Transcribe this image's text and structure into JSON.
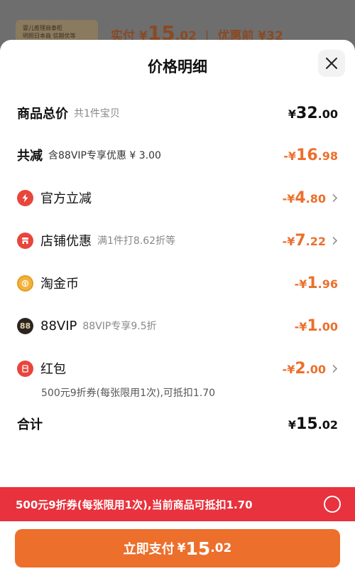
{
  "background": {
    "thumb_lines": [
      "婴儿推理商泰柜",
      "明照日本商 信期优等"
    ],
    "paid_label": "实付",
    "paid_symbol": "¥",
    "paid_int": "15",
    "paid_dec": ".02",
    "separator": "|",
    "before_discount": "优惠前 ¥32"
  },
  "sheet": {
    "title": "价格明细",
    "close_icon": "close-icon"
  },
  "rows": {
    "total": {
      "label": "商品总价",
      "sub": "共1件宝贝",
      "sym": "¥",
      "int": "32",
      "dec": ".00"
    },
    "reduce": {
      "label": "共减",
      "sub": "含88VIP专享优惠 ¥ 3.00",
      "sym": "-¥",
      "int": "16",
      "dec": ".98"
    },
    "official": {
      "label": "官方立减",
      "sym": "-¥",
      "int": "4",
      "dec": ".80",
      "icon": "lightning-icon"
    },
    "store": {
      "label": "店铺优惠",
      "sub": "满1件打8.62折等",
      "sym": "-¥",
      "int": "7",
      "dec": ".22",
      "icon": "shop-icon"
    },
    "coin": {
      "label": "淘金币",
      "sym": "-¥",
      "int": "1",
      "dec": ".96",
      "icon": "coin-icon"
    },
    "vip": {
      "label": "88VIP",
      "sub": "88VIP专享9.5折",
      "sym": "-¥",
      "int": "1",
      "dec": ".00",
      "icon_text": "88"
    },
    "hongbao": {
      "label": "红包",
      "note": "500元9折券(每张限用1次),可抵扣1.70",
      "sym": "-¥",
      "int": "2",
      "dec": ".00",
      "icon": "red-envelope-icon"
    },
    "sum": {
      "label": "合计",
      "sym": "¥",
      "int": "15",
      "dec": ".02"
    }
  },
  "coupon_bar": {
    "text": "500元9折券(每张限用1次),当前商品可抵扣1.70"
  },
  "pay_button": {
    "label": "立即支付",
    "sym": "¥",
    "int": "15",
    "dec": ".02"
  },
  "colors": {
    "accent_orange": "#ec6f2c",
    "coupon_red": "#e8323d"
  }
}
